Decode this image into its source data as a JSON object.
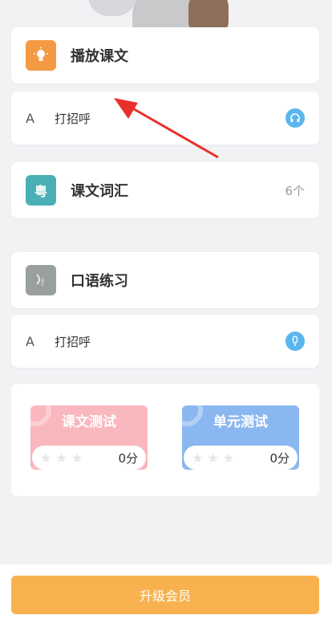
{
  "sections": {
    "play_text": {
      "title": "播放课文",
      "icon": "lightbulb-icon",
      "color": "#f39a42"
    },
    "play_row": {
      "tag": "A",
      "label": "打招呼",
      "icon": "headphones-icon"
    },
    "vocab": {
      "title": "课文词汇",
      "count": "6个",
      "icon": "cantonese-char-icon",
      "color": "#4ab0b5"
    },
    "oral": {
      "title": "口语练习",
      "icon": "oral-practice-icon",
      "color": "#9aa09b"
    },
    "oral_row": {
      "tag": "A",
      "label": "打招呼",
      "icon": "microphone-icon"
    }
  },
  "tests": {
    "lesson_test": {
      "label": "课文测试",
      "score": "0分",
      "color": "#f9b7be"
    },
    "unit_test": {
      "label": "单元测试",
      "score": "0分",
      "color": "#8bb7f0"
    }
  },
  "bottom": {
    "upgrade_label": "升级会员",
    "color": "#f7b24f"
  }
}
